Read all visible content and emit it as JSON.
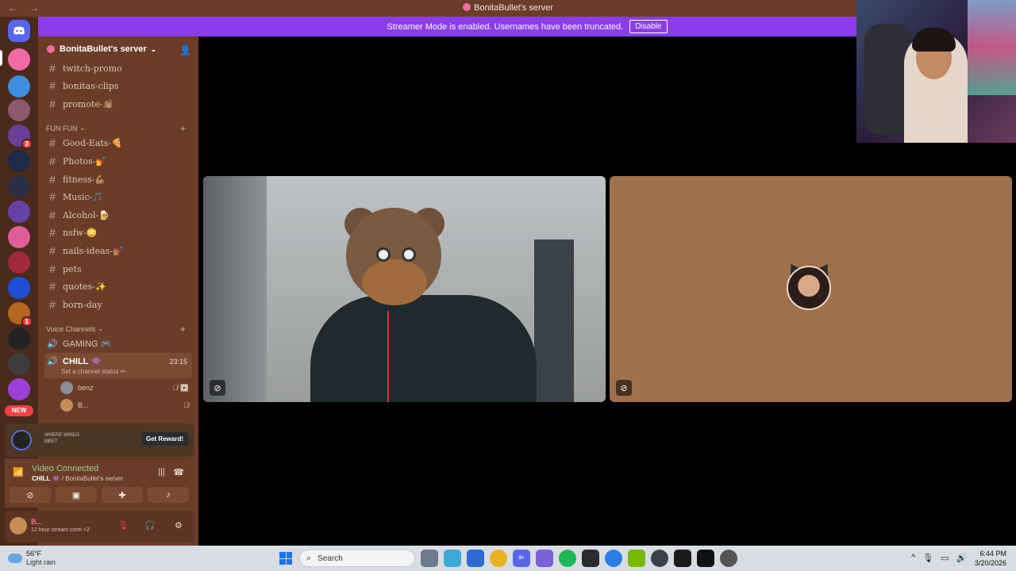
{
  "window": {
    "title": "BonitaBullet's server",
    "nav": "← →"
  },
  "banner": {
    "message": "Streamer Mode is enabled. Usernames have been truncated.",
    "button": "Disable"
  },
  "rail": {
    "badges": [
      "3",
      "1"
    ],
    "new_label": "NEW"
  },
  "server": {
    "name": "BonitaBullet's server",
    "chevron": "⌄",
    "invite_icon": "add-user-icon"
  },
  "channels_top": [
    {
      "name": "twitch-promo"
    },
    {
      "name": "bonitas-clips"
    },
    {
      "name": "promote-👏🏽"
    }
  ],
  "category_fun": {
    "label": "FUN FUN",
    "chevron": "⌄",
    "plus": "+"
  },
  "channels_fun": [
    {
      "name": "Good-Eats-🍕"
    },
    {
      "name": "Photos-💅"
    },
    {
      "name": "fitness-💪🏽"
    },
    {
      "name": "Music-🎵"
    },
    {
      "name": "Alcohol-🍺"
    },
    {
      "name": "nsfw-😳"
    },
    {
      "name": "nails-ideas-💅🏽"
    },
    {
      "name": "pets"
    },
    {
      "name": "quotes-✨"
    },
    {
      "name": "born-day"
    }
  ],
  "category_voice": {
    "label": "Voice Channels",
    "chevron": "⌄",
    "plus": "+"
  },
  "voice_channels": [
    {
      "name": "GAMING 🎮",
      "active": false
    },
    {
      "name": "CHILL 👾",
      "active": true,
      "timer": "23:15",
      "status": "Set a channel status ✏"
    }
  ],
  "voice_members": [
    {
      "name": "benz",
      "icons": "🎙̸ ▶"
    },
    {
      "name": "B...",
      "icons": "🎙̸"
    }
  ],
  "promo": {
    "game": "WHERE WINDS MEET",
    "button": "Get Reward!"
  },
  "voice_panel": {
    "title": "Video Connected",
    "channel": "CHILL 👾",
    "server": " / BonitaBullet's server"
  },
  "user_panel": {
    "name": "B...",
    "status": "12 hour stream comi",
    "status_extra": "+2"
  },
  "taskbar": {
    "temp": "56°F",
    "weather": "Light rain",
    "search": "Search",
    "time": "6:44 PM",
    "date": "3/20/2026",
    "discord_badge": "9+"
  }
}
